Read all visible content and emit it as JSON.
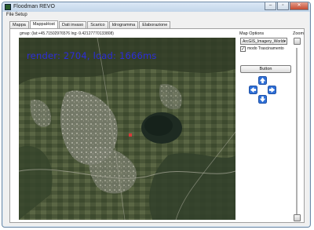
{
  "window": {
    "title": "Floodman REVO",
    "controls": [
      "–",
      "▫",
      "✕"
    ]
  },
  "menu": [
    {
      "label": "File"
    },
    {
      "label": "Setup"
    }
  ],
  "tabs": [
    {
      "label": "Mappa",
      "active": false
    },
    {
      "label": "MappaHost",
      "active": true
    },
    {
      "label": "Dati invaso",
      "active": false
    },
    {
      "label": "Scarico",
      "active": false
    },
    {
      "label": "Idrogramma",
      "active": false
    },
    {
      "label": "Elaborazione",
      "active": false
    }
  ],
  "map_panel": {
    "coords_label": "gmap: (lat:+45.71502976576  lng:-9.42127770133808)",
    "render_info": "render: 2704, load: 1666ms"
  },
  "options": {
    "title": "Map Options",
    "map_type_selected": "ArcGIS_Imagery_World",
    "mode_checkbox": {
      "label": "modo Trascinamento",
      "checked": true
    },
    "button_label": "Button",
    "nav_arrows": [
      "up-arrow-icon",
      "left-arrow-icon",
      "right-arrow-icon",
      "down-arrow-icon"
    ]
  },
  "zoom": {
    "label": "Zoom",
    "level": 0.95
  },
  "colors": {
    "window_frame": "#d9e6f2",
    "render_text": "#2c2cd8",
    "nav_arrow": "#2f6fd6"
  }
}
